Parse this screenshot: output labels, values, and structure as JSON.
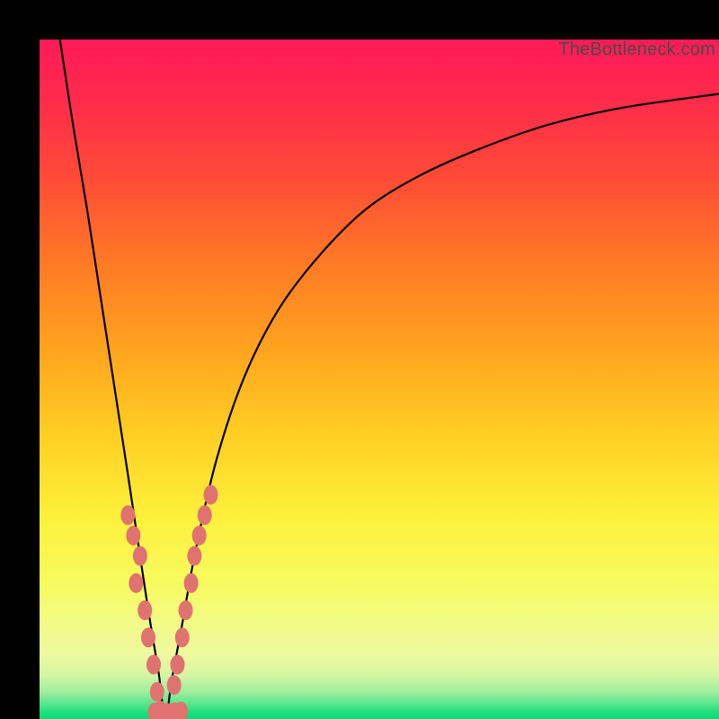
{
  "watermark": "TheBottleneck.com",
  "gradient_stops": [
    {
      "pos": 0.0,
      "color": "#ff1a58"
    },
    {
      "pos": 0.09,
      "color": "#ff2b4b"
    },
    {
      "pos": 0.2,
      "color": "#ff4a37"
    },
    {
      "pos": 0.33,
      "color": "#ff7a25"
    },
    {
      "pos": 0.46,
      "color": "#ffa51e"
    },
    {
      "pos": 0.58,
      "color": "#ffce23"
    },
    {
      "pos": 0.7,
      "color": "#fdf03a"
    },
    {
      "pos": 0.8,
      "color": "#f7fb5e"
    },
    {
      "pos": 0.86,
      "color": "#f2fb86"
    },
    {
      "pos": 0.905,
      "color": "#edfa9f"
    },
    {
      "pos": 0.935,
      "color": "#d5f6a2"
    },
    {
      "pos": 0.96,
      "color": "#a0ed9e"
    },
    {
      "pos": 0.978,
      "color": "#57e58f"
    },
    {
      "pos": 0.99,
      "color": "#1fdf7e"
    },
    {
      "pos": 1.0,
      "color": "#07dc72"
    }
  ],
  "chart_data": {
    "type": "line",
    "title": "",
    "xlabel": "",
    "ylabel": "",
    "xlim": [
      0,
      100
    ],
    "ylim": [
      0,
      100
    ],
    "optimum_x": 18.5,
    "series": [
      {
        "name": "bottleneck-curve",
        "x": [
          3,
          5,
          7,
          9,
          11,
          13,
          14.5,
          16,
          17.5,
          18.5,
          19.5,
          21,
          23,
          26,
          30,
          35,
          41,
          48,
          56,
          65,
          75,
          86,
          100
        ],
        "y": [
          100,
          87,
          75,
          62,
          49,
          36,
          26,
          16,
          7,
          0,
          6,
          14,
          25,
          38,
          50,
          60,
          68,
          75,
          80,
          84,
          87.5,
          90,
          92
        ]
      }
    ],
    "annotations": [
      {
        "name": "left-cluster",
        "type": "points",
        "color": "#e0736f",
        "x": [
          13.0,
          13.8,
          14.8,
          14.2,
          15.5,
          16.0,
          16.8,
          17.3,
          17.8
        ],
        "y": [
          30,
          27,
          24,
          20,
          16,
          12,
          8,
          4,
          1.2
        ]
      },
      {
        "name": "right-cluster",
        "type": "points",
        "color": "#e0736f",
        "x": [
          19.8,
          20.3,
          21.0,
          21.5,
          22.3,
          22.8,
          23.5,
          24.3,
          25.2
        ],
        "y": [
          5,
          8,
          12,
          16,
          20,
          24,
          27,
          30,
          33
        ]
      },
      {
        "name": "bottom-cluster",
        "type": "points",
        "color": "#e0736f",
        "x": [
          17.0,
          18.0,
          18.8,
          19.8,
          20.8
        ],
        "y": [
          1.0,
          0.9,
          0.9,
          1.0,
          1.1
        ]
      }
    ]
  }
}
